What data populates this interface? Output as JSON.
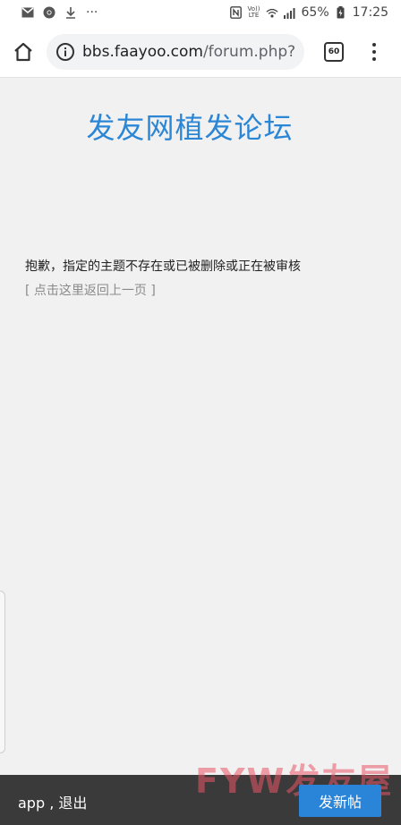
{
  "status_bar": {
    "battery": "65%",
    "time": "17:25",
    "volte_top": "Vo))",
    "volte_bottom": "LTE",
    "dots": "···"
  },
  "browser": {
    "url_host": "bbs.faayoo.com",
    "url_path": "/forum.php?",
    "tab_count": "60"
  },
  "page": {
    "site_title": "发友网植发论坛",
    "error_message": "抱歉，指定的主题不存在或已被删除或正在被审核",
    "back_link_open": "[ ",
    "back_link_label": "点击这里返回上一页",
    "back_link_close": " ]"
  },
  "bottom_bar": {
    "links_text": "app , 退出",
    "new_post_label": "发新帖",
    "watermark": "FYW发友屋"
  }
}
